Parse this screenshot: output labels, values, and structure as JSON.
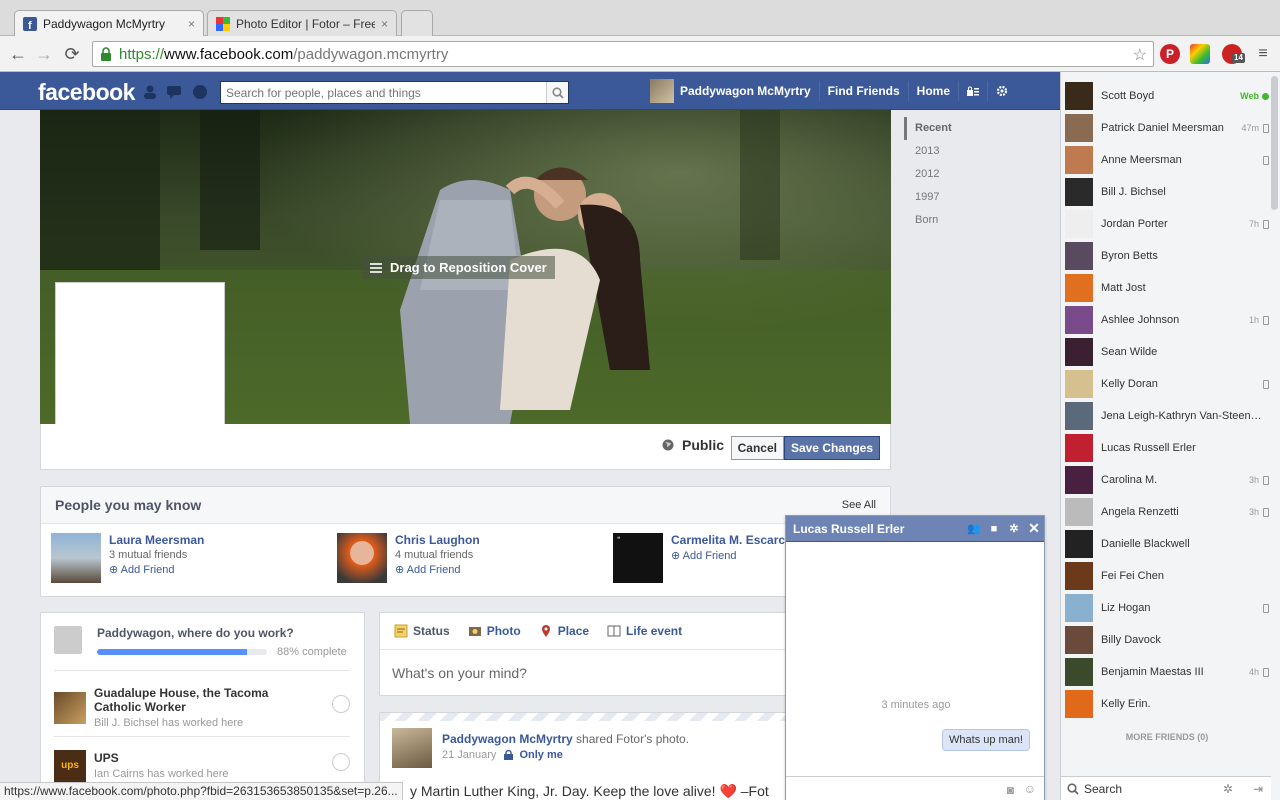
{
  "browser": {
    "tabs": [
      {
        "title": "Paddywagon McMyrtry",
        "close": "×"
      },
      {
        "title": "Photo Editor | Fotor – Free",
        "close": "×"
      }
    ],
    "url": {
      "scheme": "https://",
      "host": "www.facebook.com",
      "path": "/paddywagon.mcmyrtry"
    },
    "extension_badge": "14"
  },
  "fb": {
    "logo": "facebook",
    "search_placeholder": "Search for people, places and things",
    "nav": {
      "profile_name": "Paddywagon McMyrtry",
      "find_friends": "Find Friends",
      "home": "Home"
    }
  },
  "cover": {
    "drag_label": "Drag to Reposition Cover",
    "privacy": "Public",
    "cancel": "Cancel",
    "save": "Save Changes"
  },
  "timeline_nav": [
    "Recent",
    "2013",
    "2012",
    "1997",
    "Born"
  ],
  "pymk": {
    "title": "People you may know",
    "see_all": "See All",
    "people": [
      {
        "name": "Laura Meersman",
        "mutual": "3 mutual friends",
        "add": "Add Friend"
      },
      {
        "name": "Chris Laughon",
        "mutual": "4 mutual friends",
        "add": "Add Friend"
      },
      {
        "name": "Carmelita M. Escarce",
        "mutual": "",
        "add": "Add Friend"
      }
    ]
  },
  "work": {
    "question": "Paddywagon, where do you work?",
    "progress_percent": 88,
    "progress_text": "88% complete",
    "items": [
      {
        "title": "Guadalupe House, the Tacoma Catholic Worker",
        "sub": "Bill J. Bichsel has worked here"
      },
      {
        "title": "UPS",
        "sub": "Ian Cairns has worked here"
      }
    ]
  },
  "composer": {
    "tabs": [
      "Status",
      "Photo",
      "Place",
      "Life event"
    ],
    "prompt": "What's on your mind?"
  },
  "post": {
    "author": "Paddywagon McMyrtry",
    "action": "shared Fotor's photo.",
    "date": "21 January",
    "audience": "Only me",
    "message": "y Martin Luther King, Jr. Day. Keep the love alive! ❤️ –Fot"
  },
  "chat": {
    "name": "Lucas Russell Erler",
    "timestamp": "3 minutes ago",
    "message": "Whats up man!"
  },
  "sidebar": {
    "friends": [
      {
        "name": "Scott Boyd",
        "status": "Web",
        "dot": true,
        "mobile": false
      },
      {
        "name": "Patrick Daniel Meersman",
        "status": "47m",
        "dot": false,
        "mobile": true
      },
      {
        "name": "Anne Meersman",
        "status": "",
        "dot": false,
        "mobile": true
      },
      {
        "name": "Bill J. Bichsel",
        "status": "",
        "dot": false,
        "mobile": false
      },
      {
        "name": "Jordan Porter",
        "status": "7h",
        "dot": false,
        "mobile": true
      },
      {
        "name": "Byron Betts",
        "status": "",
        "dot": false,
        "mobile": false
      },
      {
        "name": "Matt Jost",
        "status": "",
        "dot": false,
        "mobile": false
      },
      {
        "name": "Ashlee Johnson",
        "status": "1h",
        "dot": false,
        "mobile": true
      },
      {
        "name": "Sean Wilde",
        "status": "",
        "dot": false,
        "mobile": false
      },
      {
        "name": "Kelly Doran",
        "status": "",
        "dot": false,
        "mobile": true
      },
      {
        "name": "Jena Leigh-Kathryn Van-Steenwyk",
        "status": "",
        "dot": false,
        "mobile": false
      },
      {
        "name": "Lucas Russell Erler",
        "status": "",
        "dot": false,
        "mobile": false
      },
      {
        "name": "Carolina M.",
        "status": "3h",
        "dot": false,
        "mobile": true
      },
      {
        "name": "Angela Renzetti",
        "status": "3h",
        "dot": false,
        "mobile": true
      },
      {
        "name": "Danielle Blackwell",
        "status": "",
        "dot": false,
        "mobile": false
      },
      {
        "name": "Fei Fei Chen",
        "status": "",
        "dot": false,
        "mobile": false
      },
      {
        "name": "Liz Hogan",
        "status": "",
        "dot": false,
        "mobile": true
      },
      {
        "name": "Billy Davock",
        "status": "",
        "dot": false,
        "mobile": false
      },
      {
        "name": "Benjamin Maestas III",
        "status": "4h",
        "dot": false,
        "mobile": true
      },
      {
        "name": "Kelly Erin.",
        "status": "",
        "dot": false,
        "mobile": false
      }
    ],
    "more_friends": "MORE FRIENDS (0)",
    "search": "Search"
  },
  "statusbar": "https://www.facebook.com/photo.php?fbid=263153653850135&set=p.26...",
  "colors": {
    "fb_blue": "#3b5998",
    "link": "#3b5998",
    "online": "#42b72a"
  }
}
